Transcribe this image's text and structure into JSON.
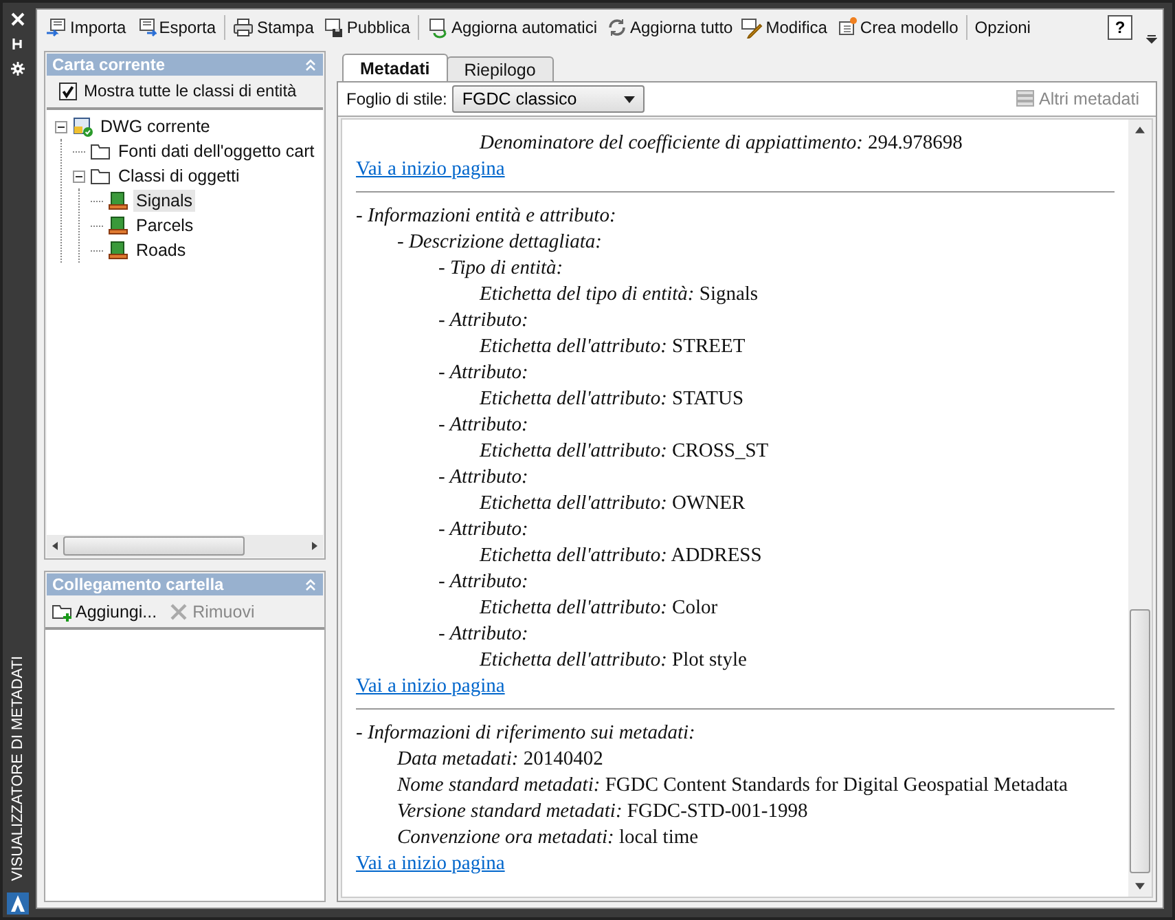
{
  "side_strip": {
    "title": "VISUALIZZATORE DI METADATI"
  },
  "toolbar": [
    {
      "label": "Importa",
      "kind": "import",
      "divider_before": false
    },
    {
      "label": "Esporta",
      "kind": "export",
      "divider_before": false
    },
    {
      "label": "Stampa",
      "kind": "print",
      "divider_before": true
    },
    {
      "label": "Pubblica",
      "kind": "publish",
      "divider_before": false
    },
    {
      "label": "Aggiorna automatici",
      "kind": "refresh",
      "divider_before": true
    },
    {
      "label": "Aggiorna tutto",
      "kind": "refresh_all",
      "divider_before": false
    },
    {
      "label": "Modifica",
      "kind": "edit",
      "divider_before": false
    },
    {
      "label": "Crea modello",
      "kind": "template",
      "divider_before": false
    },
    {
      "label": "Opzioni",
      "kind": "text",
      "divider_before": true
    },
    {
      "label": "?",
      "kind": "help",
      "divider_before": false
    }
  ],
  "map_panel": {
    "title": "Carta corrente",
    "show_all": {
      "label": "Mostra tutte le classi di entità",
      "checked": true
    },
    "tree": [
      {
        "label": "DWG corrente",
        "kind": "dwg",
        "expanded": true,
        "selected": false,
        "children": [
          {
            "label": "Fonti dati dell'oggetto cart",
            "kind": "folder",
            "selected": false
          },
          {
            "label": "Classi di oggetti",
            "kind": "folder",
            "expanded": true,
            "selected": false,
            "children": [
              {
                "label": "Signals",
                "kind": "layer",
                "selected": true
              },
              {
                "label": "Parcels",
                "kind": "layer",
                "selected": false
              },
              {
                "label": "Roads",
                "kind": "layer",
                "selected": false
              }
            ]
          }
        ]
      }
    ]
  },
  "folder_panel": {
    "title": "Collegamento cartella",
    "actions": [
      {
        "label": "Aggiungi...",
        "kind": "add",
        "disabled": false
      },
      {
        "label": "Rimuovi",
        "kind": "remove",
        "disabled": true
      }
    ]
  },
  "tabs": [
    {
      "label": "Metadati",
      "selected": true
    },
    {
      "label": "Riepilogo",
      "selected": false
    }
  ],
  "stylesheet": {
    "label": "Foglio di stile:",
    "value": "FGDC classico"
  },
  "more_metadata": {
    "label": "Altri metadati",
    "disabled": true
  },
  "content": [
    {
      "kind": "continued",
      "entries": [
        {
          "label": "Denominatore del coefficiente di appiattimento:",
          "value": "294.978698"
        }
      ],
      "link": "Vai a inizio pagina"
    },
    {
      "kind": "section",
      "entries": [
        {
          "label": "- Informazioni entità e attributo:",
          "children": [
            {
              "label": "- Descrizione dettagliata:",
              "children": [
                {
                  "label": "- Tipo di entità:",
                  "children": [
                    {
                      "label": "Etichetta del tipo di entità:",
                      "value": "Signals"
                    }
                  ]
                },
                {
                  "label": "- Attributo:",
                  "children": [
                    {
                      "label": "Etichetta dell'attributo:",
                      "value": "STREET"
                    }
                  ]
                },
                {
                  "label": "- Attributo:",
                  "children": [
                    {
                      "label": "Etichetta dell'attributo:",
                      "value": "STATUS"
                    }
                  ]
                },
                {
                  "label": "- Attributo:",
                  "children": [
                    {
                      "label": "Etichetta dell'attributo:",
                      "value": "CROSS_ST"
                    }
                  ]
                },
                {
                  "label": "- Attributo:",
                  "children": [
                    {
                      "label": "Etichetta dell'attributo:",
                      "value": "OWNER"
                    }
                  ]
                },
                {
                  "label": "- Attributo:",
                  "children": [
                    {
                      "label": "Etichetta dell'attributo:",
                      "value": "ADDRESS"
                    }
                  ]
                },
                {
                  "label": "- Attributo:",
                  "children": [
                    {
                      "label": "Etichetta dell'attributo:",
                      "value": "Color"
                    }
                  ]
                },
                {
                  "label": "- Attributo:",
                  "children": [
                    {
                      "label": "Etichetta dell'attributo:",
                      "value": "Plot style"
                    }
                  ]
                }
              ]
            }
          ]
        }
      ],
      "link": "Vai a inizio pagina"
    },
    {
      "kind": "section",
      "entries": [
        {
          "label": "- Informazioni di riferimento sui metadati:",
          "children": [
            {
              "label": "Data metadati:",
              "value": "20140402"
            },
            {
              "label": "Nome standard metadati:",
              "value": "FGDC Content Standards for Digital Geospatial Metadata"
            },
            {
              "label": "Versione standard metadati:",
              "value": "FGDC-STD-001-1998"
            },
            {
              "label": "Convenzione ora metadati:",
              "value": "local time"
            }
          ]
        }
      ],
      "link": "Vai a inizio pagina"
    }
  ]
}
